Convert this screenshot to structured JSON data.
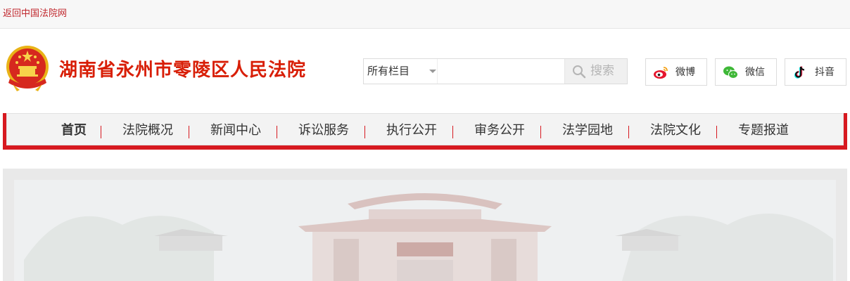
{
  "topbar": {
    "back_link": "返回中国法院网"
  },
  "header": {
    "title": "湖南省永州市零陵区人民法院"
  },
  "search": {
    "scope_selected": "所有栏目",
    "placeholder": "",
    "button_label": "搜索"
  },
  "social": [
    {
      "label": "微博",
      "icon": "weibo-icon"
    },
    {
      "label": "微信",
      "icon": "wechat-icon"
    },
    {
      "label": "抖音",
      "icon": "douyin-icon"
    }
  ],
  "nav": {
    "items": [
      {
        "label": "首页",
        "active": true
      },
      {
        "label": "法院概况"
      },
      {
        "label": "新闻中心"
      },
      {
        "label": "诉讼服务"
      },
      {
        "label": "执行公开"
      },
      {
        "label": "审务公开"
      },
      {
        "label": "法学园地"
      },
      {
        "label": "法院文化"
      },
      {
        "label": "专题报道"
      }
    ]
  },
  "colors": {
    "brand_red": "#d81e06",
    "nav_bar_red": "#d71920",
    "link_red": "#c0272d"
  }
}
